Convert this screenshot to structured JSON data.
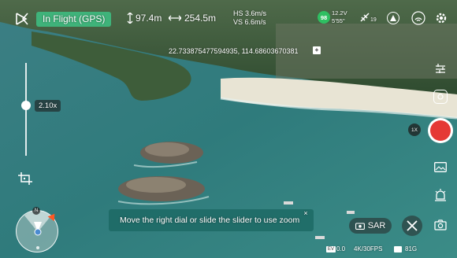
{
  "top_bar": {
    "flight_status": "In Flight (GPS)",
    "altitude": "97.4m",
    "distance": "254.5m",
    "hs": "HS 3.6m/s",
    "vs": "VS 6.6m/s",
    "battery_percent": "98",
    "battery_voltage": "12.2V",
    "battery_time": "5'55\"",
    "satellite_count": "19"
  },
  "gps_coords": "22.733875477594935, 114.68603670381",
  "zoom_level": "2.10x",
  "camera_zoom": "1X",
  "tip_text": "Move the right dial or slide the slider to use zoom",
  "sar_label": "SAR",
  "compass_north": "N",
  "bottom_info": {
    "ev": "0.0",
    "ev_badge": "EV",
    "resolution": "4K/30FPS",
    "storage": "81G"
  },
  "colors": {
    "status_green": "#3fb37a",
    "record_red": "#e53935",
    "tip_bg": "#1c6964",
    "compass_accent": "#ff5722"
  }
}
